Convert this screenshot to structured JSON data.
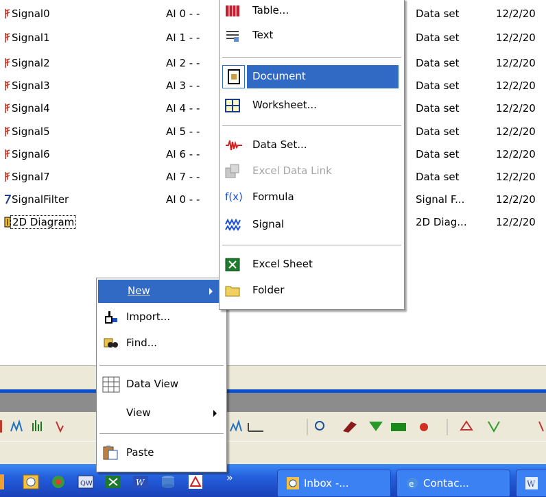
{
  "file_list": {
    "rows": [
      {
        "name": "Signal0",
        "channel": "AI 0 - -",
        "type": "Data set",
        "date": "12/2/20"
      },
      {
        "name": "Signal1",
        "channel": "AI 1 - -",
        "type": "Data set",
        "date": "12/2/20"
      },
      {
        "name": "Signal2",
        "channel": "AI 2 - -",
        "type": "Data set",
        "date": "12/2/20"
      },
      {
        "name": "Signal3",
        "channel": "AI 3 - -",
        "type": "Data set",
        "date": "12/2/20"
      },
      {
        "name": "Signal4",
        "channel": "AI 4 - -",
        "type": "Data set",
        "date": "12/2/20"
      },
      {
        "name": "Signal5",
        "channel": "AI 5 - -",
        "type": "Data set",
        "date": "12/2/20"
      },
      {
        "name": "Signal6",
        "channel": "AI 6 - -",
        "type": "Data set",
        "date": "12/2/20"
      },
      {
        "name": "Signal7",
        "channel": "AI 7 - -",
        "type": "Data set",
        "date": "12/2/20"
      },
      {
        "name": "SignalFilter",
        "channel": "AI 0 - -",
        "type": "Signal F...",
        "date": "12/2/20"
      },
      {
        "name": "2D Diagram",
        "channel": "",
        "type": "2D Diag...",
        "date": "12/2/20"
      }
    ]
  },
  "context_menu": {
    "items": {
      "new": "New",
      "import": "Import...",
      "find": "Find...",
      "data_view": "Data View",
      "view": "View",
      "paste": "Paste"
    }
  },
  "new_submenu": {
    "items": {
      "table": "Table...",
      "text": "Text",
      "document": "Document",
      "worksheet": "Worksheet...",
      "data_set": "Data Set...",
      "excel_data_link": "Excel Data Link",
      "formula": "Formula",
      "formula_icon": "f(x)",
      "signal": "Signal",
      "excel_sheet": "Excel Sheet",
      "folder": "Folder"
    }
  },
  "taskbar": {
    "overflow": "»",
    "buttons": {
      "inbox": "Inbox -...",
      "contacts": "Contac..."
    }
  },
  "colors": {
    "highlight": "#316ac5",
    "taskbar": "#245edb",
    "signal_icon": "#c0392b"
  }
}
